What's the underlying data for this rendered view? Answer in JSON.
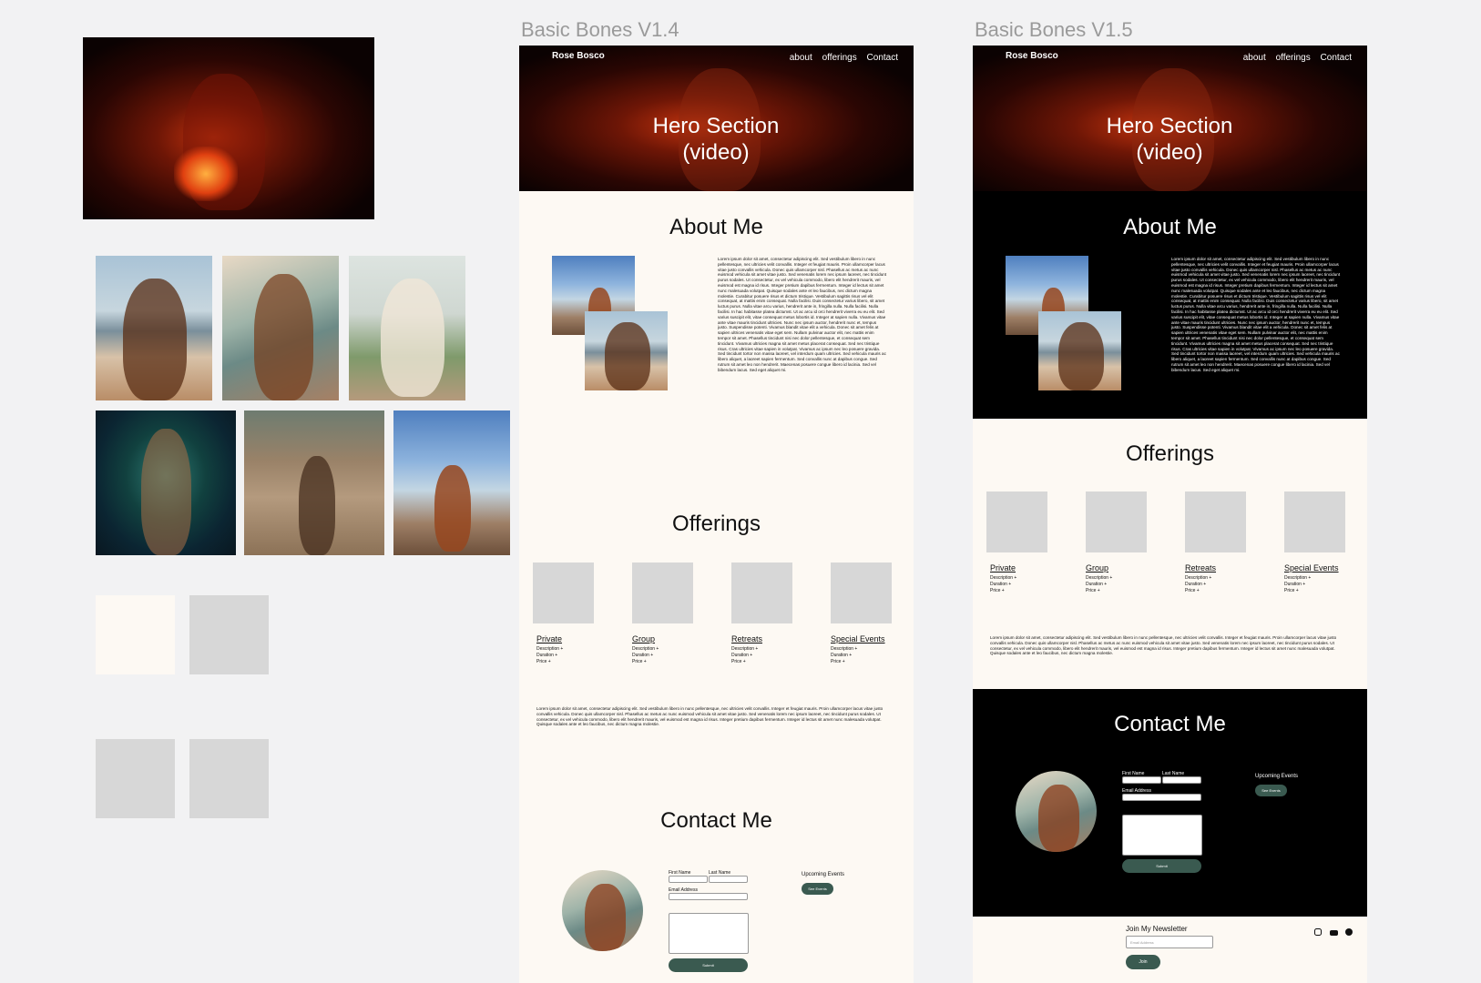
{
  "frames": {
    "v14_title": "Basic Bones V1.4",
    "v15_title": "Basic Bones V1.5"
  },
  "site": {
    "brand": "Rose Bosco",
    "nav": [
      "about",
      "offerings",
      "Contact"
    ],
    "hero": "Hero Section (video)",
    "about_heading": "About Me",
    "offerings_heading": "Offerings",
    "contact_heading": "Contact Me",
    "about_text": "Lorem ipsum dolor sit amet, consectetur adipiscing elit. Sed vestibulum libero in nunc pellentesque, nec ultricies velit convallis. Integer et feugiat mauris. Proin ullamcorper lacus vitae justo convallis vehicula. Donec quis ullamcorper nisl. Phasellus ac metus ac nunc euismod vehicula sit amet vitae justo. Sed venenatis lorem nec ipsum laoreet, nec tincidunt purus sodales. Ut consectetur, ex vel vehicula commodo, libero elit hendrerit mauris, vel euismod est magna id risus. Integer pretium dapibus fermentum. Integer id lectus sit amet nunc malesuada volutpat. Quisque sodales ante et leo faucibus, nec dictum magna molestie. Curabitur posuere risus et dictum tristique. Vestibulum sagittis risus vel elit consequat, at mattis enim consequat. Nulla facilisi. Duis consectetur varius libero, sit amet luctus purus. Nulla vitae arcu varius, hendrerit ante in, fringilla nulla. Nulla facilisi. Nulla facilisi. In hac habitasse platea dictumst. Ut ac arcu id orci hendrerit viverra eu eu elit. Sed varius suscipit elit, vitae consequat metus lobortis id. Integer at sapien nulla. Vivamus vitae ante vitae mauris tincidunt ultricies. Nunc nec ipsum auctor, hendrerit nunc et, tempus justo. Suspendisse potenti. Vivamus blandit vitae elit a vehicula. Donec sit amet felis at sapien ultrices venenatis vitae eget sem. Nullam pulvinar auctor elit, nec mattis enim tempor sit amet. Phasellus tincidunt nisi nec dolor pellentesque, et consequat sem tincidunt. Vivamus ultricies magna sit amet metus placerat consequat. Sed nec tristique risus. Cras ultricies vitae sapien in volutpat. Vivamus ac ipsum nec leo posuere gravida. Sed tincidunt tortor non massa laoreet, vel interdum quam ultricies. Sed vehicula mauris ac libero aliquet, a laoreet sapien fermentum. Sed convallis nunc at dapibus congue. Sed rutrum sit amet leo non hendrerit. Maecenas posuere congue libero id lacinia. Sed vel bibendum lacus. Sed eget aliquet mi.",
    "offerings": [
      {
        "label": "Private",
        "lines": [
          "Description +",
          "Duration +",
          "Price +"
        ]
      },
      {
        "label": "Group",
        "lines": [
          "Description +",
          "Duration +",
          "Price +"
        ]
      },
      {
        "label": "Retreats",
        "lines": [
          "Description +",
          "Duration +",
          "Price +"
        ]
      },
      {
        "label": "Special Events",
        "lines": [
          "Description +",
          "Duration +",
          "Price +"
        ]
      }
    ],
    "offerings_text": "Lorem ipsum dolor sit amet, consectetur adipiscing elit. Sed vestibulum libero in nunc pellentesque, nec ultricies velit convallis. Integer et feugiat mauris. Proin ullamcorper lacus vitae justo convallis vehicula. Donec quis ullamcorper nisl. Phasellus ac metus ac nunc euismod vehicula sit amet vitae justo. Sed venenatis lorem nec ipsum laoreet, nec tincidunt purus sodales. Ut consectetur, ex vel vehicula commodo, libero elit hendrerit mauris, vel euismod est magna id risus. Integer pretium dapibus fermentum. Integer id lectus sit amet nunc malesuada volutpat. Quisque sodales ante et leo faucibus, nec dictum magna molestie.",
    "contact": {
      "first_name": "First Name",
      "last_name": "Last Name",
      "email": "Email Address",
      "upcoming": "Upcoming Events",
      "submit": "Submit",
      "see_events": "See Events"
    },
    "newsletter": {
      "title": "Join My Newsletter",
      "placeholder": "Email Address",
      "join": "Join"
    }
  },
  "icons": [
    "instagram-icon",
    "youtube-icon",
    "spotify-icon"
  ]
}
